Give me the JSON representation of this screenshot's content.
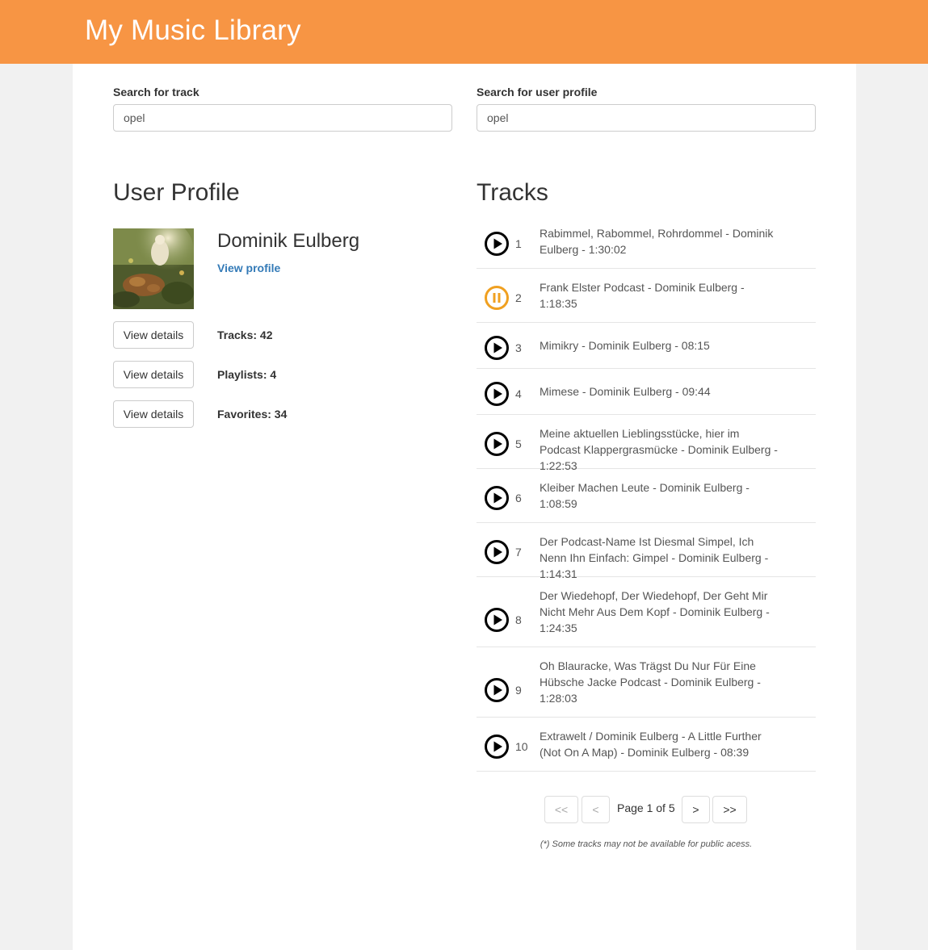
{
  "app": {
    "title": "My Music Library"
  },
  "search": {
    "track_label": "Search for track",
    "track_value": "opel",
    "user_label": "Search for user profile",
    "user_value": "opel"
  },
  "profile": {
    "heading": "User Profile",
    "name": "Dominik Eulberg",
    "link": "View profile",
    "details_button": "View details",
    "stats": [
      "Tracks: 42",
      "Playlists: 4",
      "Favorites: 34"
    ]
  },
  "tracks": {
    "heading": "Tracks",
    "items": [
      {
        "num": "1",
        "title": "Rabimmel, Rabommel, Rohrdommel - Dominik Eulberg - 1:30:02",
        "state": "play"
      },
      {
        "num": "2",
        "title": "Frank Elster Podcast - Dominik Eulberg - 1:18:35",
        "state": "pause"
      },
      {
        "num": "3",
        "title": "Mimikry - Dominik Eulberg - 08:15",
        "state": "play"
      },
      {
        "num": "4",
        "title": "Mimese - Dominik Eulberg - 09:44",
        "state": "play"
      },
      {
        "num": "5",
        "title": "Meine aktuellen Lieblingsstücke, hier im Podcast Klappergrasmücke - Dominik Eulberg - 1:22:53",
        "state": "play"
      },
      {
        "num": "6",
        "title": "Kleiber Machen Leute - Dominik Eulberg - 1:08:59",
        "state": "play"
      },
      {
        "num": "7",
        "title": "Der Podcast-Name Ist Diesmal Simpel, Ich Nenn Ihn Einfach: Gimpel - Dominik Eulberg - 1:14:31",
        "state": "play"
      },
      {
        "num": "8",
        "title": "Der Wiedehopf, Der Wiedehopf, Der Geht Mir Nicht Mehr Aus Dem Kopf - Dominik Eulberg - 1:24:35",
        "state": "play"
      },
      {
        "num": "9",
        "title": "Oh Blauracke, Was Trägst Du Nur Für Eine Hübsche Jacke Podcast - Dominik Eulberg - 1:28:03",
        "state": "play"
      },
      {
        "num": "10",
        "title": "Extrawelt / Dominik Eulberg - A Little Further (Not On A Map) - Dominik Eulberg - 08:39",
        "state": "play"
      }
    ]
  },
  "pagination": {
    "first": "<<",
    "prev": "<",
    "info": "Page 1 of 5",
    "next": ">",
    "last": ">>"
  },
  "footnote": "(*) Some tracks may not be available for public acess.",
  "colors": {
    "header": "#f79544",
    "play_icon": "#000000",
    "pause_icon": "#f0a020",
    "link": "#337ab7"
  }
}
